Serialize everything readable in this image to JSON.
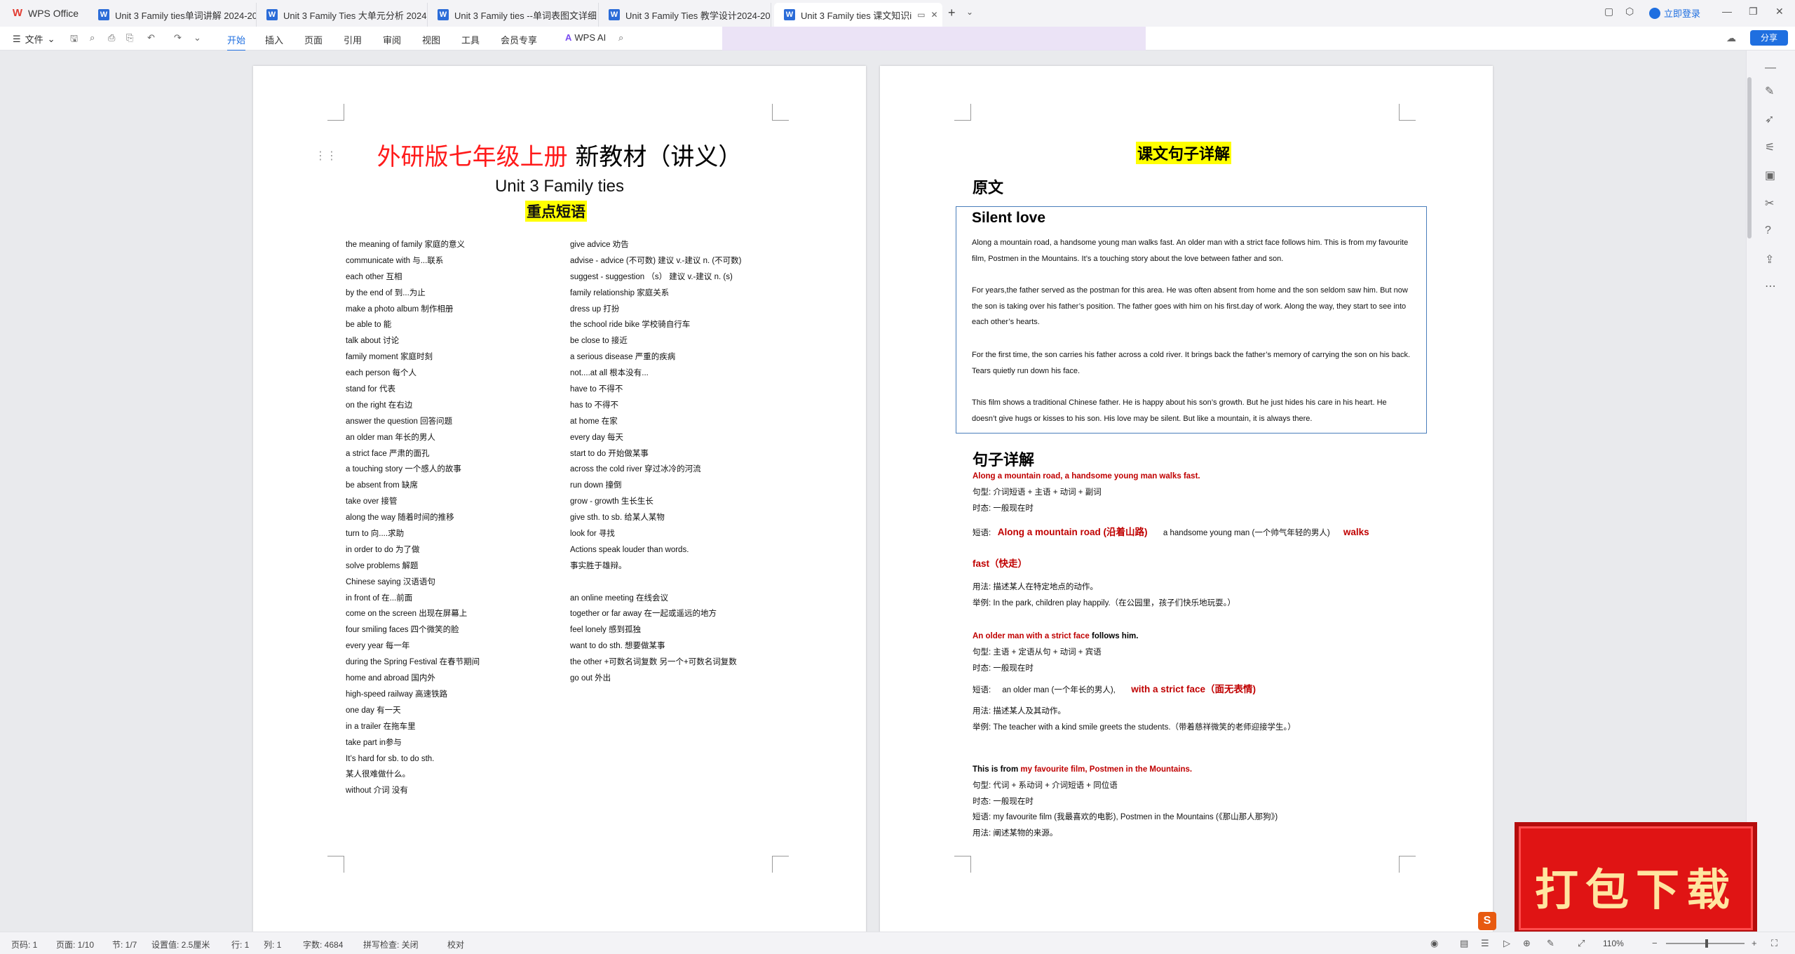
{
  "app": {
    "name": "WPS Office"
  },
  "tabs": [
    {
      "label": "Unit 3  Family ties单词讲解 2024-20"
    },
    {
      "label": "Unit 3 Family Ties 大单元分析 2024"
    },
    {
      "label": "Unit 3 Family ties --单词表图文详细"
    },
    {
      "label": "Unit 3 Family Ties 教学设计2024-20"
    },
    {
      "label": "Unit 3 Family ties 课文知识i"
    }
  ],
  "titlebar": {
    "login": "立即登录"
  },
  "toolbar": {
    "file": "文件",
    "ribbon": [
      "开始",
      "插入",
      "页面",
      "引用",
      "审阅",
      "视图",
      "工具",
      "会员专享"
    ],
    "wps_ai": "WPS AI",
    "share": "分享"
  },
  "page1": {
    "title_red": "外研版七年级上册",
    "title_black": "新教材（讲义）",
    "subtitle": "Unit 3 Family ties",
    "heading": "重点短语",
    "left_phrases": [
      "the meaning of family          家庭的意义",
      "communicate with        与...联系",
      "each other  互相",
      "by the end of        到...为止",
      "make a photo album    制作相册",
      "be able to    能",
      "talk about   讨论",
      "family moment    家庭时刻",
      "each person        每个人",
      "stand for     代表",
      "on the right         在右边",
      "answer the question    回答问题",
      "an older man       年长的男人",
      "a strict face        严肃的面孔",
      "a touching story  一个感人的故事",
      "be absent from   缺席",
      "take over    接管",
      "along the way       随着时间的推移",
      "turn to        向....求助",
      "in order to do       为了做",
      "solve problems     解题",
      "Chinese saying      汉语语句",
      "in front of   在...前面",
      "come on the screen       出现在屏幕上",
      "four smiling faces         四个微笑的脸",
      "every year   每一年",
      "during the Spring Festival      在春节期间",
      "home and abroad         国内外",
      "high-speed railway        高速铁路",
      "one day       有一天",
      "in a trailer   在拖车里",
      "take part in参与",
      "It’s hard for sb. to do sth.",
      "某人很难做什么。",
      "without   介词     没有"
    ],
    "right_phrases": [
      "give advice 劝告",
      "advise - advice (不可数)        建议 v.-建议 n. (不可数)",
      "suggest - suggestion （s）      建议 v.-建议 n. (s)",
      "family relationship       家庭关系",
      "dress up       打扮",
      "the school ride bike       学校骑自行车",
      "be close to 接近",
      "a serious disease 严重的疾病",
      "not....at all  根本没有...",
      "have to        不得不",
      "has to         不得不",
      "at home       在家",
      "every day    每天",
      "start to do  开始做某事",
      "across the cold river      穿过冰冷的河流",
      "run down    撞倒",
      "grow - growth       生长生长",
      "give sth. to sb.      给某人某物",
      "look for        寻找",
      "Actions speak louder than words.",
      "事实胜于雄辩。",
      "",
      "an online meeting        在线会议",
      "together or far away     在一起或遥远的地方",
      "feel lonely  感到孤独",
      "want to do sth.     想要做某事",
      "the other +可数名词复数    另一个+可数名词复数",
      "go out          外出"
    ]
  },
  "page2": {
    "heading": "课文句子详解",
    "original_label": "原文",
    "text_title": "Silent love",
    "paragraphs": [
      "Along a mountain road, a handsome young man walks fast. An older man with a strict face follows him. This is from my favourite film, Postmen in the Mountains. It’s a touching story about the love between father and son.",
      "For years,the father served as the postman for this area. He was often absent from home and the son seldom saw him. But now the son is taking over his father’s position. The father goes with him on his first.day of work. Along the way, they start to see into each other’s hearts.",
      "For the first time, the son carries his father across a cold river. It brings back the father’s memory of carrying the son on his back. Tears quietly run down his face.",
      "This film shows a traditional Chinese father. He is happy about his son’s growth. But he just hides his care in his heart. He doesn’t give hugs or kisses to his son. His love may be silent. But like a mountain, it is always there."
    ],
    "detail_label": "句子详解",
    "s1": {
      "sentence": "Along a mountain road, a handsome young man walks fast.",
      "pattern": "句型:    介词短语  +  主语  +  动词  +  副词",
      "tense": "时态:    一般现在时",
      "phrase_label": "短语:",
      "phrase_a": "Along a mountain road (沿着山路)",
      "phrase_b": "a handsome young man (一个帅气年轻的男人)",
      "phrase_c": "walks",
      "phrase_d": "fast（快走）",
      "usage": "用法:    描述某人在特定地点的动作。",
      "example": "举例:    In the park, children play happily.（在公园里，孩子们快乐地玩耍。）"
    },
    "s2": {
      "sentence_red": "An older man with a strict face",
      "sentence_black": " follows him.",
      "pattern": "句型:    主语  +  定语从句  +  动词  +  宾语",
      "tense": "时态:    一般现在时",
      "phrase_label": "短语:",
      "phrase_a": "an older man (一个年长的男人),",
      "phrase_b": "with a strict face（面无表情)",
      "usage": "用法:    描述某人及其动作。",
      "example": "举例:    The teacher with a kind smile greets the students.（带着慈祥微笑的老师迎接学生。）"
    },
    "s3": {
      "sentence_black": "This is from ",
      "sentence_red": "my favourite film, Postmen in the Mountains.",
      "pattern": "句型:    代词  +  系动词  +  介词短语  +  同位语",
      "tense": "时态:    一般现在时",
      "phrase": "短语:    my favourite film (我最喜欢的电影), Postmen in the Mountains (《那山那人那狗》)",
      "usage": "用法:    阐述某物的来源。"
    }
  },
  "watermark": {
    "stamp": "打包下载"
  },
  "status": {
    "page_code": "页码: 1",
    "pages": "页面: 1/10",
    "section": "节: 1/7",
    "setting": "设置值: 2.5厘米",
    "row": "行: 1",
    "col": "列: 1",
    "words": "字数: 4684",
    "spell": "拼写检查: 关闭",
    "proof": "校对",
    "zoom": "110%"
  }
}
